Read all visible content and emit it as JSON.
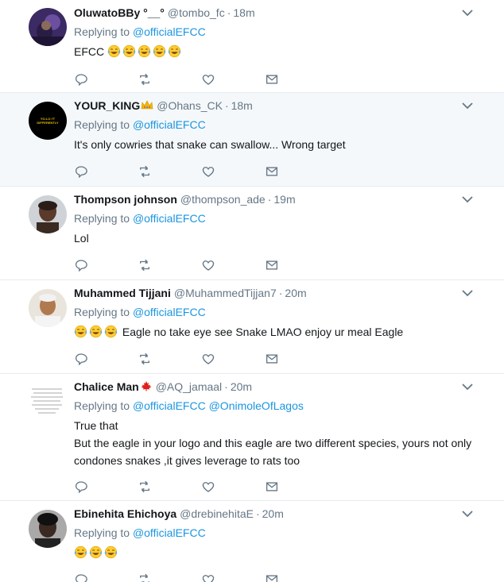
{
  "reply_prefix": "Replying to",
  "tweets": [
    {
      "name": "OluwatoBBy °__°",
      "handle": "@tombo_fc",
      "time": "18m",
      "replying_to": [
        "@officialEFCC"
      ],
      "lines": [
        "EFCC"
      ],
      "emoji_count": 5,
      "avatar_icon": "profile-photo"
    },
    {
      "name": "YOUR_KING",
      "handle": "@Ohans_CK",
      "time": "18m",
      "replying_to": [
        "@officialEFCC"
      ],
      "lines": [
        "It's only cowries that snake can swallow... Wrong target"
      ],
      "avatar_text": "YO-LO I'T DIFFERENTLY",
      "avatar_icon": "black-logo-avatar",
      "highlighted": true
    },
    {
      "name": "Thompson johnson",
      "handle": "@thompson_ade",
      "time": "19m",
      "replying_to": [
        "@officialEFCC"
      ],
      "lines": [
        "Lol"
      ],
      "avatar_icon": "profile-photo"
    },
    {
      "name": "Muhammed Tijjani",
      "handle": "@MuhammedTijjan7",
      "time": "20m",
      "replying_to": [
        "@officialEFCC"
      ],
      "lines": [
        "Eagle no take eye see Snake LMAO enjoy ur meal Eagle"
      ],
      "emoji_count": 3,
      "avatar_icon": "profile-photo"
    },
    {
      "name": "Chalice Man",
      "handle": "@AQ_jamaal",
      "time": "20m",
      "replying_to": [
        "@officialEFCC",
        "@OnimoleOfLagos"
      ],
      "lines": [
        "True that",
        "But the eagle in your logo and this eagle are two different species, yours not only condones snakes ,it gives leverage to rats too"
      ],
      "avatar_icon": "handwriting-avatar"
    },
    {
      "name": "Ebinehita Ehichoya",
      "handle": "@drebinehitaE",
      "time": "20m",
      "replying_to": [
        "@officialEFCC"
      ],
      "lines": [
        ""
      ],
      "emoji_count": 3,
      "avatar_icon": "profile-photo"
    }
  ],
  "colors": {
    "text": "#14171a",
    "muted": "#657786",
    "link": "#1b95e0",
    "divider": "#e6ecf0",
    "highlight_bg": "#f5f8fa"
  }
}
